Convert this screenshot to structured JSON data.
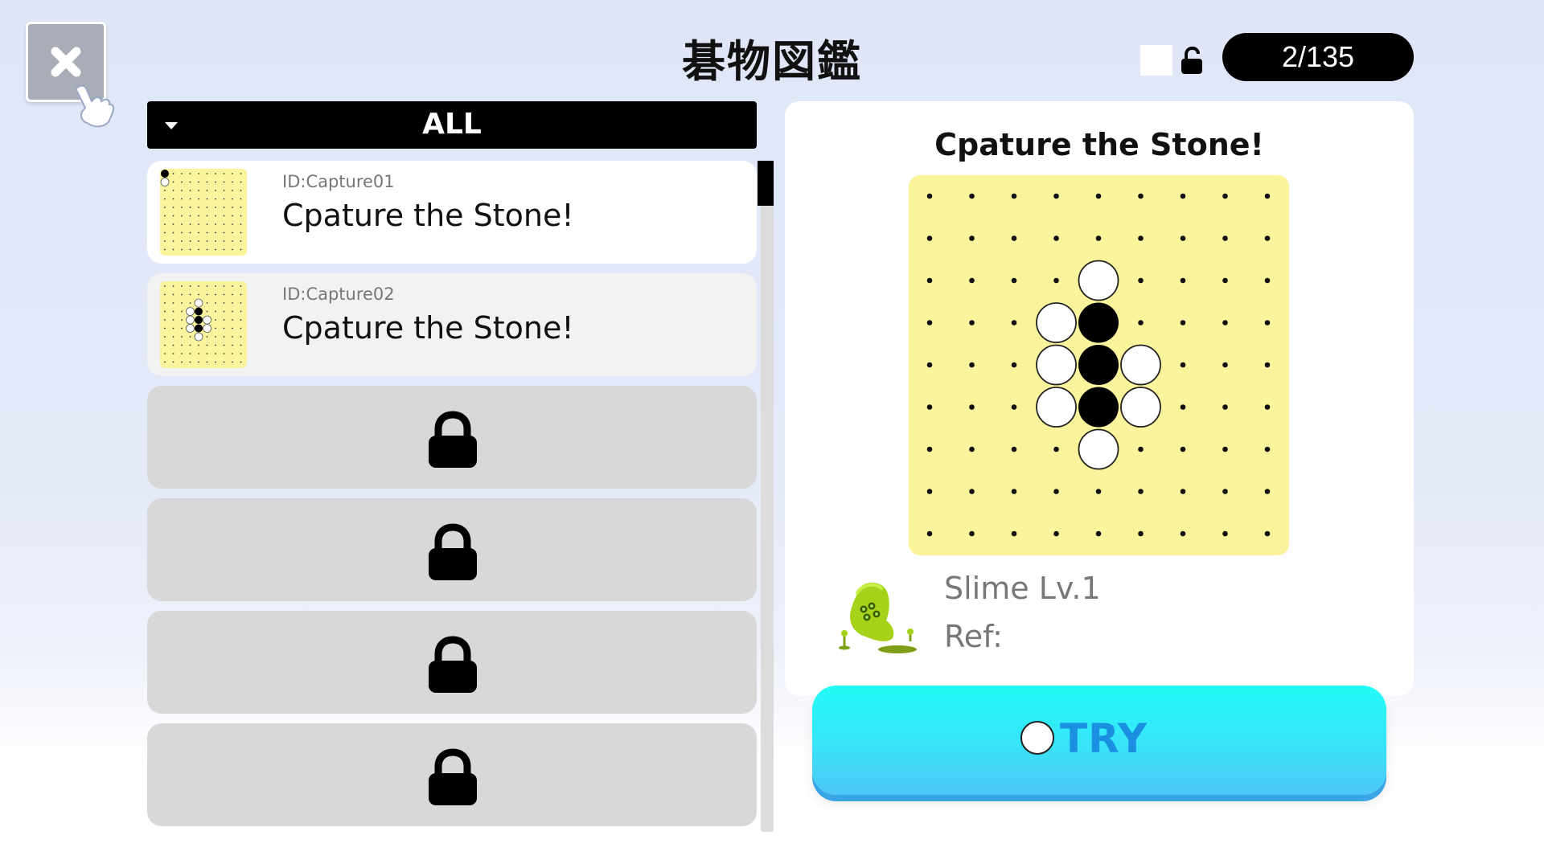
{
  "header": {
    "title": "碁物図鑑",
    "progress": "2/135",
    "close_icon": "close-icon",
    "unlock_icon": "unlock-icon"
  },
  "filter": {
    "selected": "ALL"
  },
  "list": {
    "items": [
      {
        "id": "ID:Capture01",
        "title": "Cpature the Stone!",
        "locked": false,
        "stones": {
          "black": [
            [
              0,
              0
            ]
          ],
          "white": [
            [
              0,
              1
            ]
          ]
        }
      },
      {
        "id": "ID:Capture02",
        "title": "Cpature the Stone!",
        "locked": false,
        "stones": {
          "black": [
            [
              4,
              3
            ],
            [
              4,
              4
            ],
            [
              4,
              5
            ]
          ],
          "white": [
            [
              4,
              2
            ],
            [
              3,
              3
            ],
            [
              3,
              4
            ],
            [
              5,
              4
            ],
            [
              3,
              5
            ],
            [
              5,
              5
            ],
            [
              4,
              6
            ]
          ]
        }
      },
      {
        "locked": true,
        "icon": "lock-icon"
      },
      {
        "locked": true,
        "icon": "lock-icon"
      },
      {
        "locked": true,
        "icon": "lock-icon"
      },
      {
        "locked": true,
        "icon": "lock-icon"
      }
    ]
  },
  "detail": {
    "title": "Cpature the Stone!",
    "board": {
      "size": 9,
      "black": [
        [
          4,
          3
        ],
        [
          4,
          4
        ],
        [
          4,
          5
        ]
      ],
      "white": [
        [
          4,
          2
        ],
        [
          3,
          3
        ],
        [
          3,
          4
        ],
        [
          5,
          4
        ],
        [
          3,
          5
        ],
        [
          5,
          5
        ],
        [
          4,
          6
        ]
      ]
    },
    "monster_name": "Slime Lv.1",
    "ref": "Ref:",
    "monster_icon": "slime-icon",
    "try_label": "TRY"
  },
  "colors": {
    "board": "#faf59c",
    "try_button": "#23fbf6",
    "try_text": "#1b8fe0"
  }
}
